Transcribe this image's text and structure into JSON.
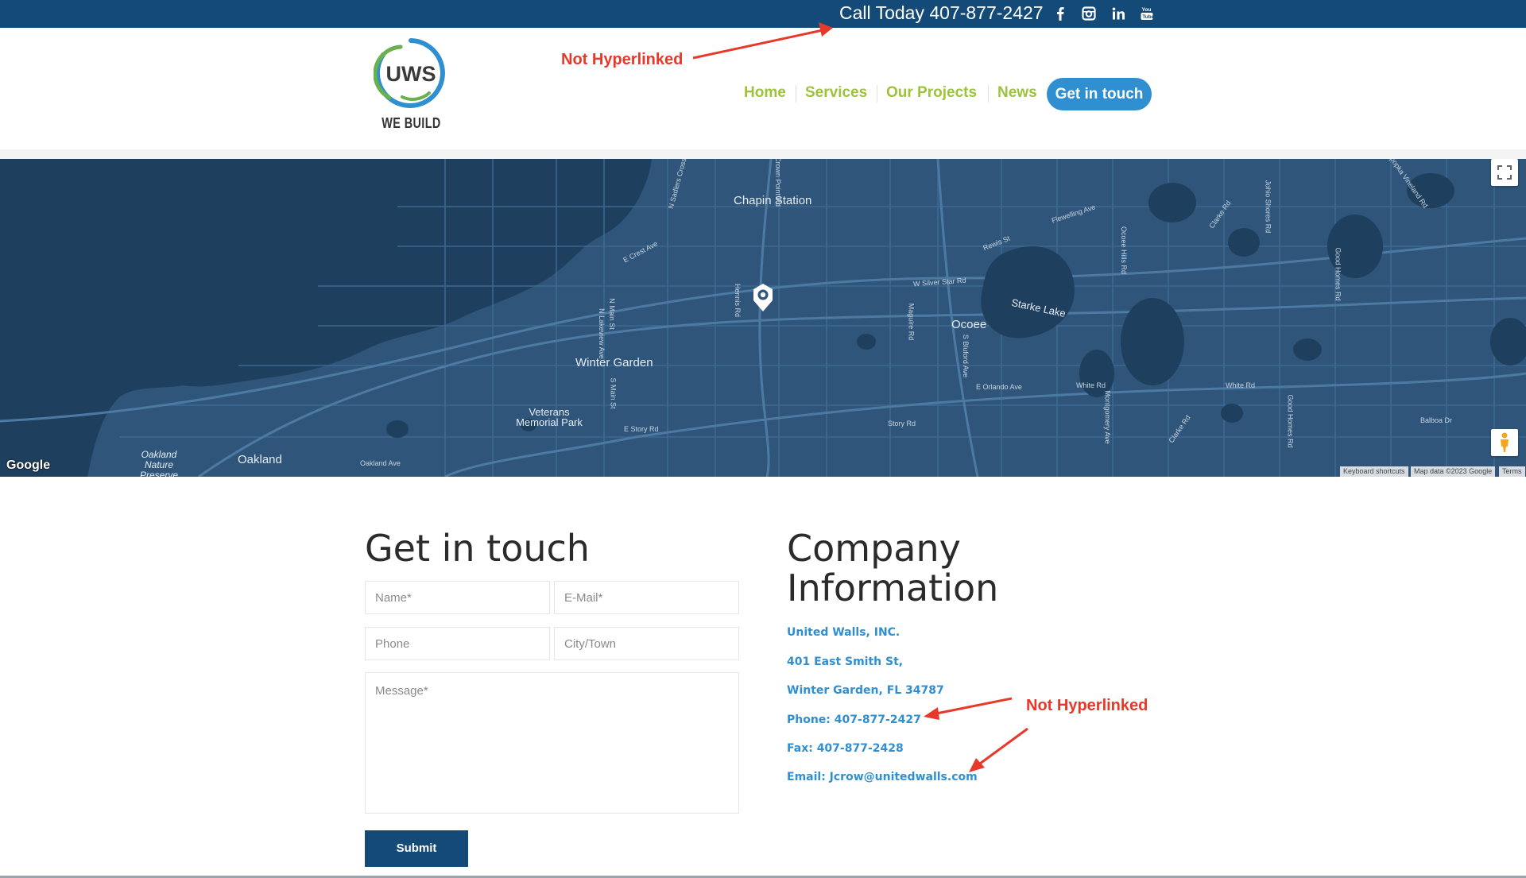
{
  "topbar": {
    "call_text": "Call Today 407-877-2427",
    "social": [
      "facebook-icon",
      "instagram-icon",
      "linkedin-icon",
      "youtube-icon"
    ]
  },
  "logo": {
    "letters": "UWS",
    "tagline": "WE BUILD"
  },
  "annotations": {
    "top": "Not Hyperlinked",
    "side": "Not Hyperlinked"
  },
  "nav": {
    "items": [
      "Home",
      "Services",
      "Our Projects",
      "News"
    ],
    "cta": "Get in touch"
  },
  "map": {
    "labels": {
      "chapin_station": "Chapin Station",
      "winter_garden": "Winter Garden",
      "veterans_park": "Veterans Memorial Park",
      "ocoee": "Ocoee",
      "starke_lake": "Starke Lake",
      "oakland": "Oakland",
      "oakland_nature": "Oakland Nature Preserve",
      "e_crest_ave": "E Crest Ave",
      "n_main_st": "N Main St",
      "s_main_st": "S Main St",
      "n_lakeview_ave": "N Lakeview Ave",
      "hennis_rd": "Hennis Rd",
      "w_silver_star_rd": "W Silver Star Rd",
      "rewis_st": "Rewis St",
      "flewelling_ave": "Flewelling Ave",
      "ocoee_hills_rd": "Ocoee Hills Rd",
      "clarke_rd": "Clarke Rd",
      "johio_shores_rd": "Johio Shores Rd",
      "good_homes_rd": "Good Homes Rd",
      "maguire_rd": "Maguire Rd",
      "s_bluford_ave": "S Bluford Ave",
      "e_orlando_ave": "E Orlando Ave",
      "white_rd": "White Rd",
      "white_rd_2": "White Rd",
      "montgomery_ave": "Montgomery Ave",
      "clarke_rd_2": "Clarke Rd",
      "good_homes_rd_2": "Good Homes Rd",
      "balboa_dr": "Balboa Dr",
      "story_rd": "Story Rd",
      "e_story_rd": "E Story Rd",
      "oakland_ave": "Oakland Ave",
      "n_sadlers_crossing": "N Sadlers Crossing",
      "w_crown_point": "W Crown Point Rd",
      "apopka_vineland": "Apopka Vineland Rd"
    },
    "google": "Google",
    "footer": {
      "shortcuts": "Keyboard shortcuts",
      "data": "Map data ©2023 Google",
      "terms": "Terms"
    }
  },
  "form": {
    "title": "Get in touch",
    "name_placeholder": "Name*",
    "email_placeholder": "E-Mail*",
    "phone_placeholder": "Phone",
    "city_placeholder": "City/Town",
    "message_placeholder": "Message*",
    "submit": "Submit"
  },
  "company": {
    "title_line1": "Company",
    "title_line2": "Information",
    "lines": [
      "United Walls, INC.",
      "401 East Smith St,",
      "Winter Garden, FL 34787",
      "Phone: 407-877-2427",
      "Fax: 407-877-2428",
      "Email: Jcrow@unitedwalls.com"
    ]
  },
  "colors": {
    "topbar": "#144a77",
    "nav_green": "#9cc33b",
    "accent_blue": "#2f8fd0",
    "map_water": "#1f3f5e",
    "map_land": "#2f567a",
    "annotation_red": "#e8382a"
  }
}
